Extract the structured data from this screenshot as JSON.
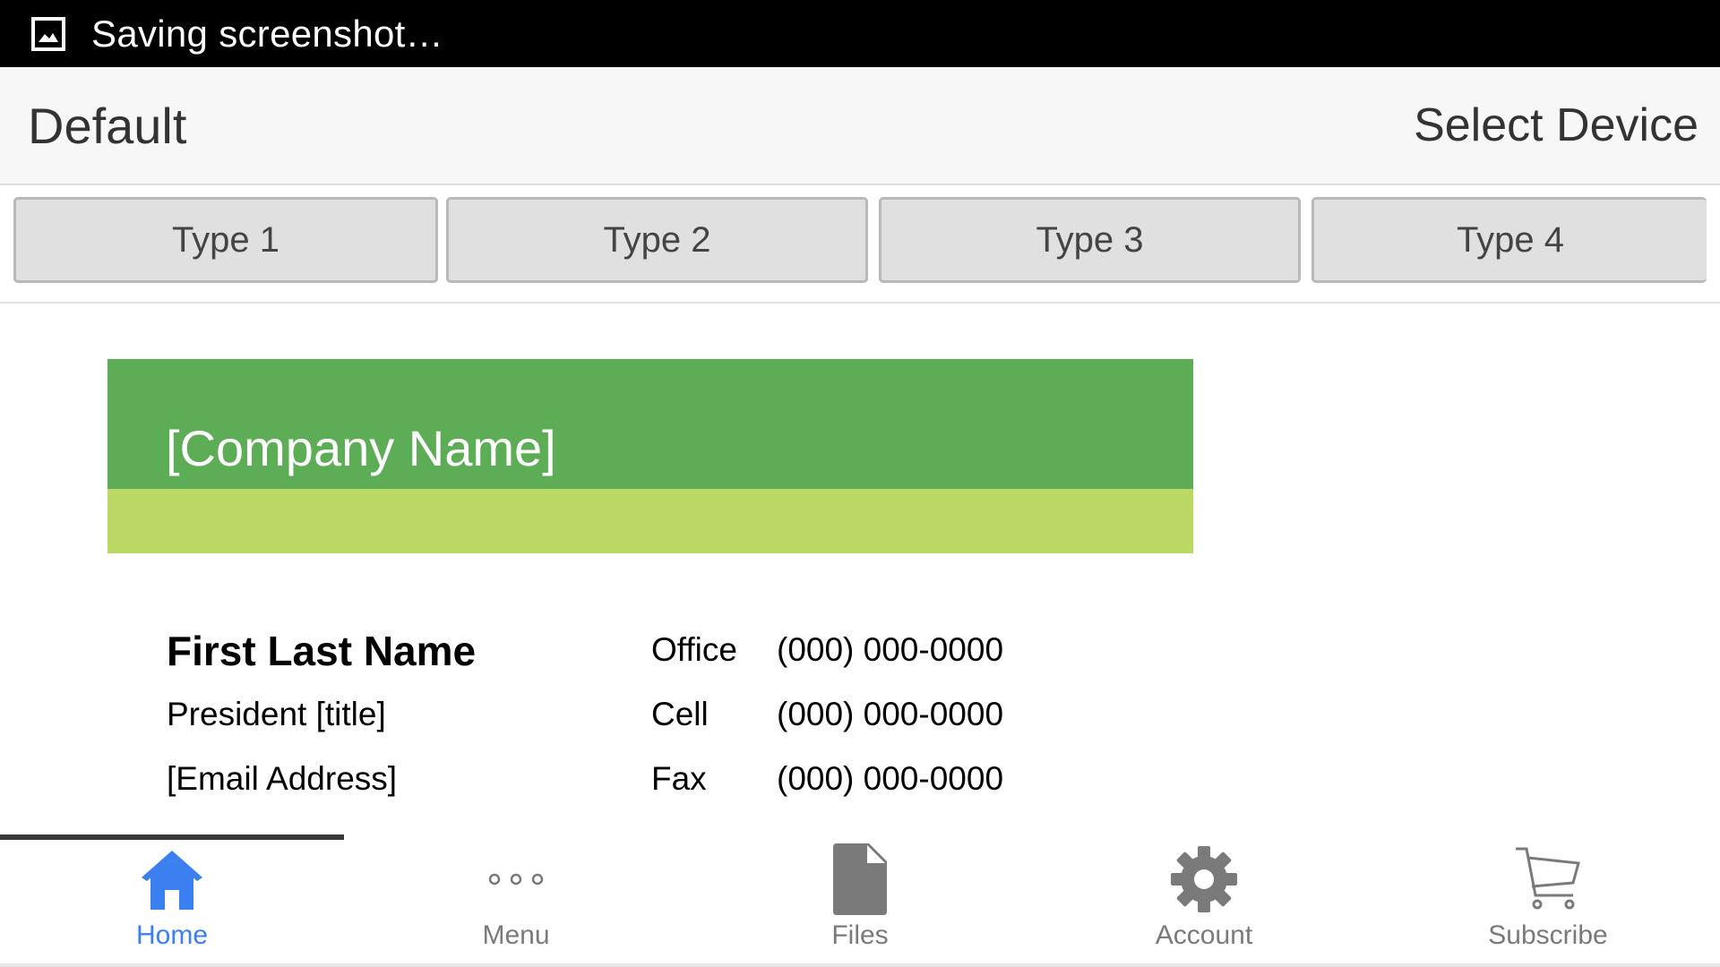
{
  "status_bar": {
    "text": "Saving screenshot…",
    "icon": "image-icon"
  },
  "app_bar": {
    "title": "Default",
    "select_device": "Select Device"
  },
  "type_tabs": [
    "Type 1",
    "Type 2",
    "Type 3",
    "Type 4"
  ],
  "card": {
    "company_name": "[Company Name]",
    "colors": {
      "header": "#5cad56",
      "accent": "#bbd764"
    },
    "contact": {
      "name": "First Last Name",
      "title": "President [title]",
      "email": "[Email Address]"
    },
    "phones": [
      {
        "label": "Office",
        "value": "(000) 000-0000"
      },
      {
        "label": "Cell",
        "value": "(000) 000-0000"
      },
      {
        "label": "Fax",
        "value": "(000) 000-0000"
      }
    ]
  },
  "bottom_nav": {
    "active_color": "#3b7ff0",
    "items": [
      {
        "label": "Home",
        "icon": "home-icon",
        "active": true
      },
      {
        "label": "Menu",
        "icon": "more-dots-icon",
        "active": false
      },
      {
        "label": "Files",
        "icon": "file-icon",
        "active": false
      },
      {
        "label": "Account",
        "icon": "gear-icon",
        "active": false
      },
      {
        "label": "Subscribe",
        "icon": "cart-icon",
        "active": false
      }
    ]
  }
}
